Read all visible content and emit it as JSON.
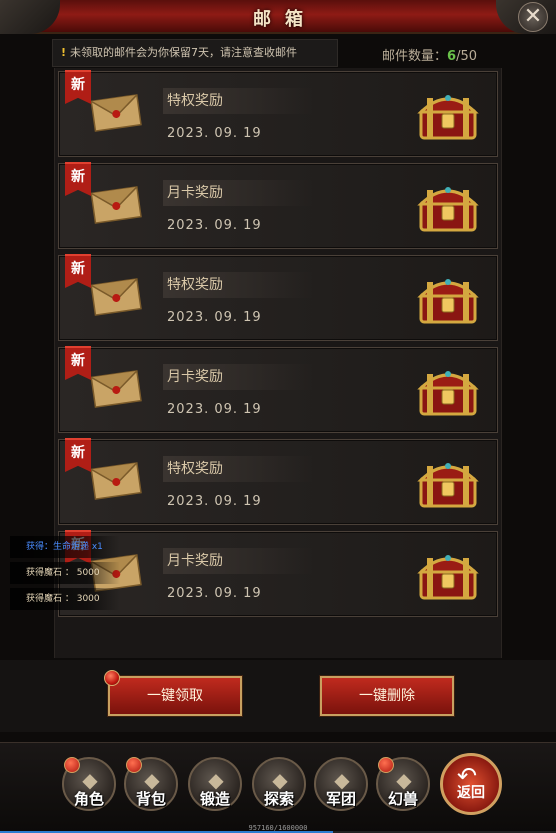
{
  "window": {
    "title": "邮箱",
    "close_symbol": "✕"
  },
  "notice": {
    "icon": "!",
    "text": "未领取的邮件会为你保留7天，请注意查收邮件"
  },
  "mail_count": {
    "label": "邮件数量：",
    "current": "6",
    "separator": "/",
    "max": "50"
  },
  "mails": [
    {
      "badge": "新",
      "name": "特权奖励",
      "date": "2023. 09. 19",
      "icon": "envelope-icon",
      "reward_icon": "treasure-chest-icon"
    },
    {
      "badge": "新",
      "name": "月卡奖励",
      "date": "2023. 09. 19",
      "icon": "envelope-icon",
      "reward_icon": "treasure-chest-icon"
    },
    {
      "badge": "新",
      "name": "特权奖励",
      "date": "2023. 09. 19",
      "icon": "envelope-icon",
      "reward_icon": "treasure-chest-icon"
    },
    {
      "badge": "新",
      "name": "月卡奖励",
      "date": "2023. 09. 19",
      "icon": "envelope-icon",
      "reward_icon": "treasure-chest-icon"
    },
    {
      "badge": "新",
      "name": "特权奖励",
      "date": "2023. 09. 19",
      "icon": "envelope-icon",
      "reward_icon": "treasure-chest-icon"
    },
    {
      "badge": "新",
      "name": "月卡奖励",
      "date": "2023. 09. 19",
      "icon": "envelope-icon",
      "reward_icon": "treasure-chest-icon"
    }
  ],
  "toasts": [
    {
      "text": "获得：生命炬递 x1"
    },
    {
      "text": "获得魔石 ： 5000"
    },
    {
      "text": "获得魔石 ： 3000"
    }
  ],
  "actions": {
    "claim_all": "一键领取",
    "delete_all": "一键删除"
  },
  "nav": [
    {
      "label": "角色",
      "icon": "helmet-icon",
      "dot": true
    },
    {
      "label": "背包",
      "icon": "backpack-icon",
      "dot": true
    },
    {
      "label": "锻造",
      "icon": "gauntlet-icon",
      "dot": false
    },
    {
      "label": "探索",
      "icon": "map-icon",
      "dot": false
    },
    {
      "label": "军团",
      "icon": "fist-icon",
      "dot": false
    },
    {
      "label": "幻兽",
      "icon": "beast-icon",
      "dot": true
    }
  ],
  "return_button": {
    "label": "返回",
    "icon": "return-arrow-icon"
  },
  "experience": {
    "text": "957160/1600000",
    "current": 957160,
    "max": 1600000
  },
  "colors": {
    "accent_red": "#b01e16",
    "count_green": "#6ac24a",
    "gold_border": "#c8a060"
  }
}
